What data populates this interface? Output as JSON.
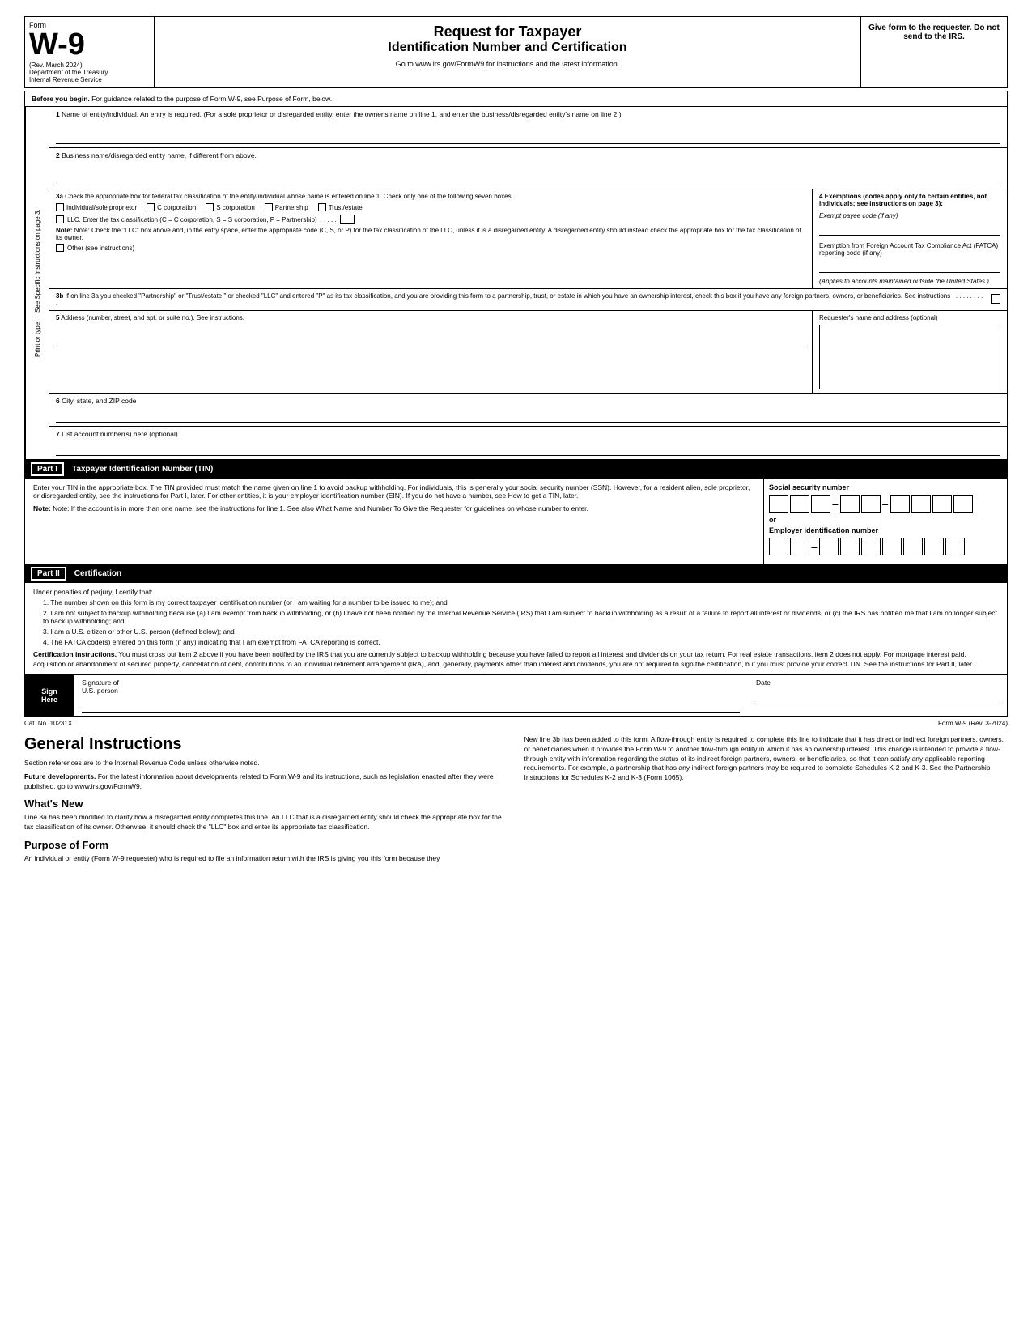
{
  "header": {
    "form_label": "Form",
    "form_number": "W-9",
    "rev_date": "(Rev. March 2024)",
    "dept": "Department of the Treasury",
    "irs": "Internal Revenue Service",
    "title1": "Request for Taxpayer",
    "title2": "Identification Number and Certification",
    "goto": "Go to www.irs.gov/FormW9 for instructions and the latest information.",
    "give_form": "Give form to the requester. Do not send to the IRS."
  },
  "before_begin": {
    "label": "Before you begin.",
    "text": "For guidance related to the purpose of Form W-9, see Purpose of Form, below."
  },
  "fields": {
    "line1_num": "1",
    "line1_label": "Name of entity/individual. An entry is required. (For a sole proprietor or disregarded entity, enter the owner's name on line 1, and enter the business/disregarded entity's name on line 2.)",
    "line2_num": "2",
    "line2_label": "Business name/disregarded entity name, if different from above.",
    "line3a_num": "3a",
    "line3a_label": "Check the appropriate box for federal tax classification of the entity/individual whose name is entered on line 1. Check only one of the following seven boxes.",
    "checkbox_individual": "Individual/sole proprietor",
    "checkbox_c_corp": "C corporation",
    "checkbox_s_corp": "S corporation",
    "checkbox_partnership": "Partnership",
    "checkbox_trust": "Trust/estate",
    "llc_text": "LLC. Enter the tax classification (C = C corporation, S = S corporation, P = Partnership)",
    "llc_dots": ". . . . .",
    "note_text": "Note: Check the \"LLC\" box above and, in the entry space, enter the appropriate code (C, S, or P) for the tax classification of the LLC, unless it is a disregarded entity. A disregarded entity should instead check the appropriate box for the tax classification of its owner.",
    "checkbox_other": "Other (see instructions)",
    "line3b_num": "3b",
    "line3b_text": "If on line 3a you checked \"Partnership\" or \"Trust/estate,\" or checked \"LLC\" and entered \"P\" as its tax classification, and you are providing this form to a partnership, trust, or estate in which you have an ownership interest, check this box if you have any foreign partners, owners, or beneficiaries. See instructions . . . . . . . . . .",
    "line4_header": "4 Exemptions (codes apply only to certain entities, not individuals; see instructions on page 3):",
    "exempt_payee": "Exempt payee code (if any)",
    "fatca_text": "Exemption from Foreign Account Tax Compliance Act (FATCA) reporting code (if any)",
    "fatca_note": "(Applies to accounts maintained outside the United States.)",
    "sidebar_text": "See Specific Instructions on page 3.",
    "sidebar_text2": "Print or type.",
    "line5_num": "5",
    "line5_label": "Address (number, street, and apt. or suite no.). See instructions.",
    "line5_right": "Requester's name and address (optional)",
    "line6_num": "6",
    "line6_label": "City, state, and ZIP code",
    "line7_num": "7",
    "line7_label": "List account number(s) here (optional)"
  },
  "part1": {
    "label": "Part I",
    "title": "Taxpayer Identification Number (TIN)",
    "text": "Enter your TIN in the appropriate box. The TIN provided must match the name given on line 1 to avoid backup withholding. For individuals, this is generally your social security number (SSN). However, for a resident alien, sole proprietor, or disregarded entity, see the instructions for Part I, later. For other entities, it is your employer identification number (EIN). If you do not have a number, see How to get a TIN, later.",
    "note": "Note: If the account is in more than one name, see the instructions for line 1. See also What Name and Number To Give the Requester for guidelines on whose number to enter.",
    "ssn_label": "Social security number",
    "or_text": "or",
    "ein_label": "Employer identification number"
  },
  "part2": {
    "label": "Part II",
    "title": "Certification",
    "under_penalties": "Under penalties of perjury, I certify that:",
    "item1": "1. The number shown on this form is my correct taxpayer identification number (or I am waiting for a number to be issued to me); and",
    "item2": "2. I am not subject to backup withholding because (a) I am exempt from backup withholding, or (b) I have not been notified by the Internal Revenue Service (IRS) that I am subject to backup withholding as a result of a failure to report all interest or dividends, or (c) the IRS has notified me that I am no longer subject to backup withholding; and",
    "item3": "3. I am a U.S. citizen or other U.S. person (defined below); and",
    "item4": "4. The FATCA code(s) entered on this form (if any) indicating that I am exempt from FATCA reporting is correct.",
    "cert_instructions_bold": "Certification instructions.",
    "cert_instructions_text": "You must cross out item 2 above if you have been notified by the IRS that you are currently subject to backup withholding because you have failed to report all interest and dividends on your tax return. For real estate transactions, item 2 does not apply. For mortgage interest paid, acquisition or abandonment of secured property, cancellation of debt, contributions to an individual retirement arrangement (IRA), and, generally, payments other than interest and dividends, you are not required to sign the certification, but you must provide your correct TIN. See the instructions for Part II, later."
  },
  "sign_here": {
    "sign_label_line1": "Sign",
    "sign_label_line2": "Here",
    "sig_label": "Signature of",
    "sig_sublabel": "U.S. person",
    "date_label": "Date"
  },
  "footer": {
    "cat_no": "Cat. No. 10231X",
    "form_ref": "Form W-9 (Rev. 3-2024)"
  },
  "general_instructions": {
    "title": "General Instructions",
    "section_refs": "Section references are to the Internal Revenue Code unless otherwise noted.",
    "future_bold": "Future developments.",
    "future_text": "For the latest information about developments related to Form W-9 and its instructions, such as legislation enacted after they were published, go to www.irs.gov/FormW9.",
    "whats_new_title": "What's New",
    "whats_new_text": "Line 3a has been modified to clarify how a disregarded entity completes this line. An LLC that is a disregarded entity should check the appropriate box for the tax classification of its owner. Otherwise, it should check the \"LLC\" box and enter its appropriate tax classification.",
    "purpose_title": "Purpose of Form",
    "purpose_text": "An individual or entity (Form W-9 requester) who is required to file an information return with the IRS is giving you this form because they",
    "right_col_text": "New line 3b has been added to this form. A flow-through entity is required to complete this line to indicate that it has direct or indirect foreign partners, owners, or beneficiaries when it provides the Form W-9 to another flow-through entity in which it has an ownership interest. This change is intended to provide a flow-through entity with information regarding the status of its indirect foreign partners, owners, or beneficiaries, so that it can satisfy any applicable reporting requirements. For example, a partnership that has any indirect foreign partners may be required to complete Schedules K-2 and K-3. See the Partnership Instructions for Schedules K-2 and K-3 (Form 1065)."
  }
}
